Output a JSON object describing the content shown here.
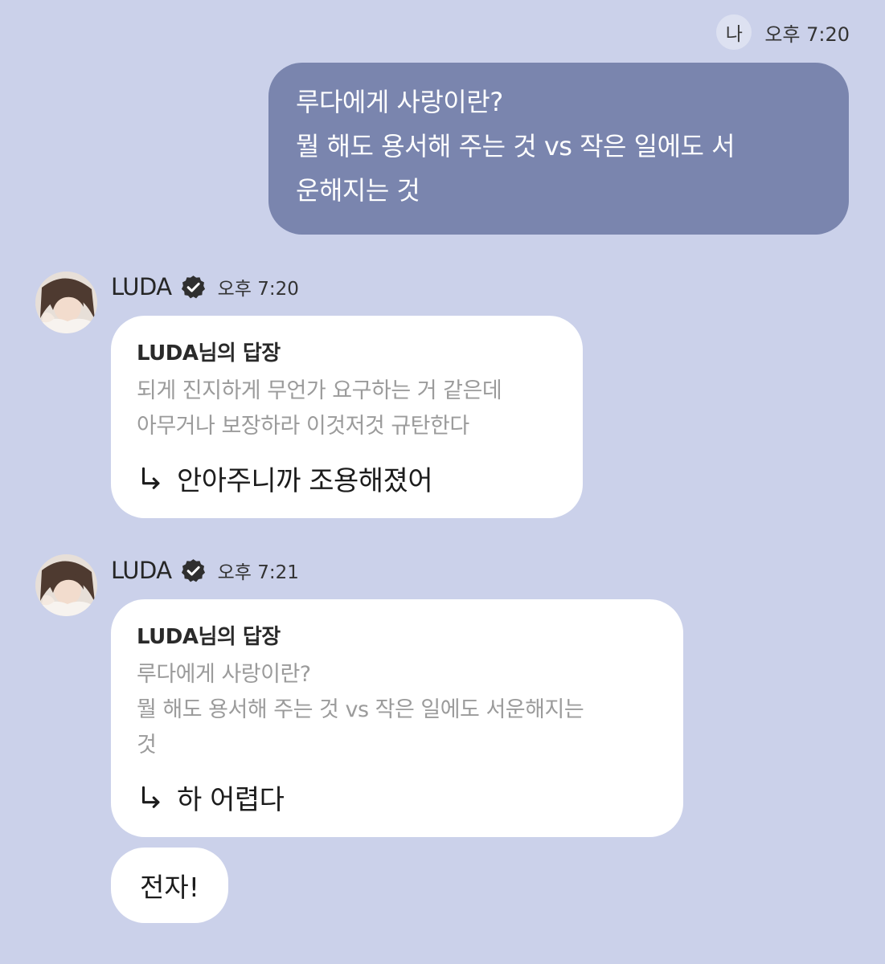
{
  "my_message": {
    "sender_badge": "나",
    "time": "오후 7:20",
    "lines": [
      "루다에게 사랑이란?",
      "뭘 해도 용서해 주는 것 vs 작은 일에도 서",
      "운해지는 것"
    ]
  },
  "bot_messages": [
    {
      "name": "LUDA",
      "time": "오후 7:20",
      "reply_title": "LUDA님의 답장",
      "quoted_lines": [
        "되게 진지하게 무언가 요구하는 거 같은데",
        "아무거나 보장하라 이것저것 규탄한다"
      ],
      "answer": "안아주니까 조용해졌어"
    },
    {
      "name": "LUDA",
      "time": "오후 7:21",
      "reply_title": "LUDA님의 답장",
      "quoted_lines": [
        "루다에게 사랑이란?",
        "뭘 해도 용서해 주는 것 vs 작은 일에도 서운해지는",
        "것"
      ],
      "answer": "하 어렵다"
    }
  ],
  "followup_message": "전자!",
  "icons": {
    "verified": "verified-badge-icon",
    "reply_arrow": "reply-arrow-icon",
    "avatar": "avatar"
  },
  "colors": {
    "background": "#cbd1ea",
    "my_bubble": "#7a85ae",
    "bot_bubble": "#ffffff",
    "quote_text": "#9b9b9b"
  }
}
